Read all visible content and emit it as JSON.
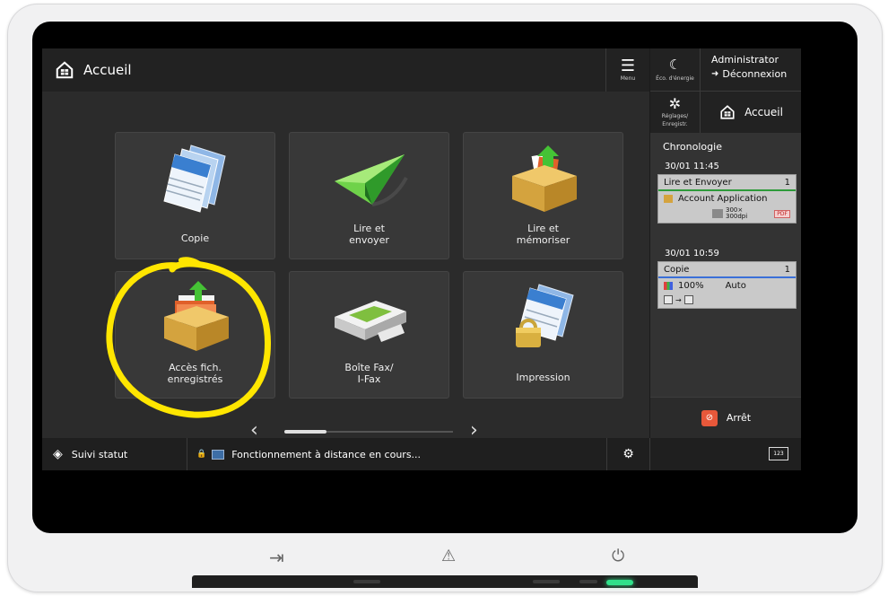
{
  "header": {
    "title": "Accueil",
    "menu_label": "Menu"
  },
  "right_panel": {
    "eco_label": "Éco. d'énergie",
    "user_name": "Administrator",
    "logout_label": "Déconnexion",
    "settings_label_1": "Réglages/",
    "settings_label_2": "Enregistr.",
    "home_label": "Accueil",
    "history_title": "Chronologie",
    "jobs": [
      {
        "time": "30/01 11:45",
        "name": "Lire et Envoyer",
        "count": "1",
        "detail": "Account Application",
        "resolution_1": "300×",
        "resolution_2": "300dpi",
        "format": "PDF"
      },
      {
        "time": "30/01 10:59",
        "name": "Copie",
        "count": "1",
        "zoom": "100%",
        "paper": "Auto"
      }
    ],
    "stop_label": "Arrêt",
    "keypad_label": "123"
  },
  "tiles": [
    {
      "label": "Copie"
    },
    {
      "label": "Lire et\nenvoyer"
    },
    {
      "label": "Lire et\nmémoriser"
    },
    {
      "label": "Accès fich.\nenregistrés"
    },
    {
      "label": "Boîte Fax/\nI-Fax"
    },
    {
      "label": "Impression"
    }
  ],
  "pager": {
    "position": 0.0,
    "visible_fraction": 0.25
  },
  "statusbar": {
    "status_label": "Suivi statut",
    "message": "Fonctionnement à distance en cours..."
  },
  "colors": {
    "annotation": "#ffe600",
    "stop": "#e8583a",
    "led": "#30e08a"
  }
}
